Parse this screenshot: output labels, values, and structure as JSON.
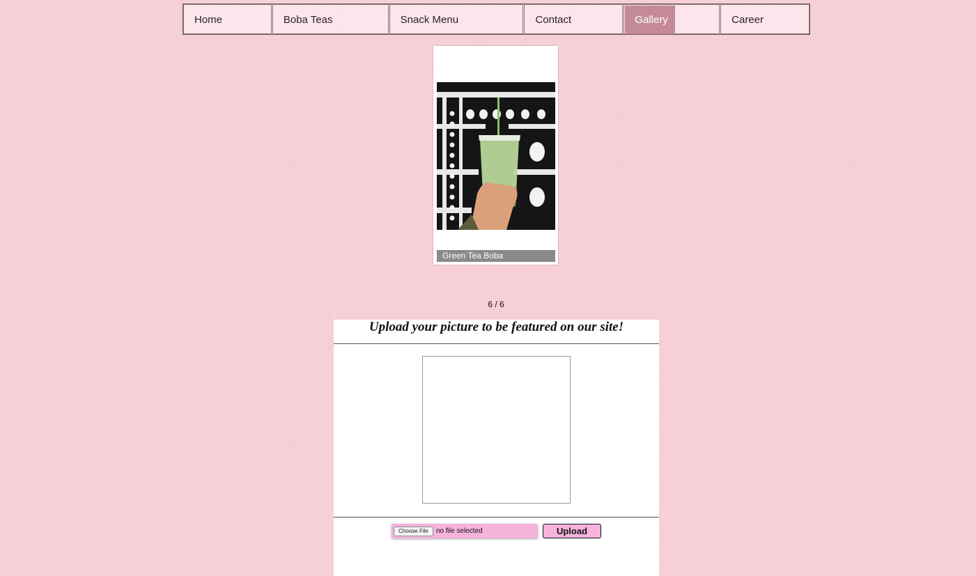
{
  "nav": {
    "items": [
      {
        "label": "Home"
      },
      {
        "label": "Boba Teas"
      },
      {
        "label": "Snack Menu"
      },
      {
        "label": "Contact"
      },
      {
        "label": "Gallery",
        "active": true
      },
      {
        "label": "Career"
      }
    ]
  },
  "gallery": {
    "caption": "Green Tea Boba",
    "counter": "6 / 6"
  },
  "upload": {
    "title": "Upload your picture to be featured on our site!",
    "choose_file_label": "Choose File",
    "file_status": "no file selected",
    "upload_button_label": "Upload"
  },
  "colors": {
    "background": "#f7cfd8",
    "active_nav": "#c48a99",
    "upload_pink": "#f6b3dc",
    "caption_bar": "#8a8a8a"
  }
}
